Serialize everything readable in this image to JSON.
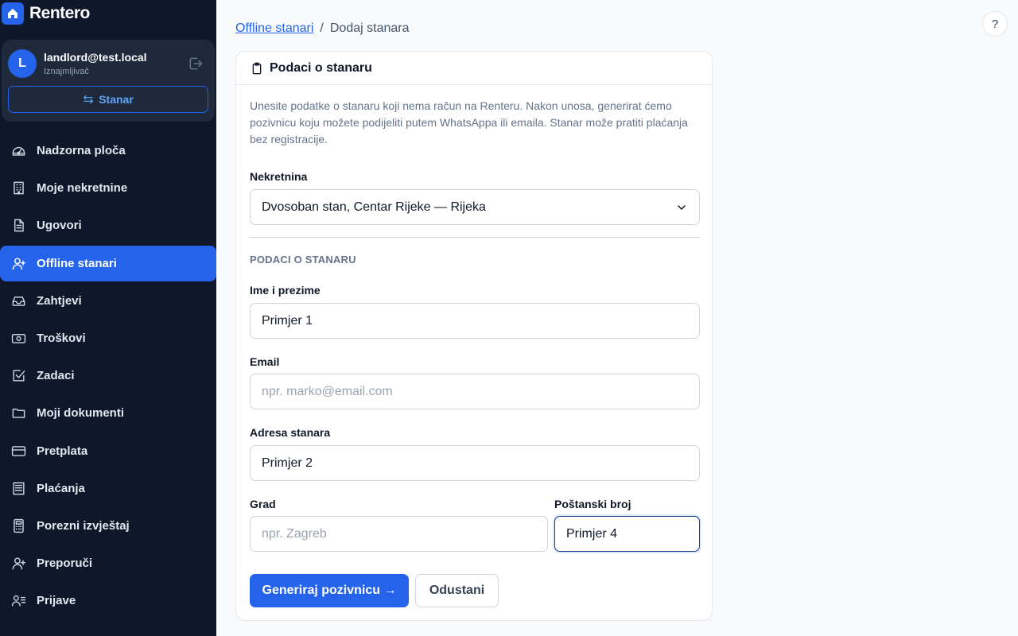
{
  "app": {
    "name": "Rentero"
  },
  "user": {
    "initial": "L",
    "email": "landlord@test.local",
    "role": "Iznajmljivač",
    "switch_label": "Stanar"
  },
  "nav": {
    "items": [
      {
        "label": "Nadzorna ploča",
        "icon": "gauge-icon"
      },
      {
        "label": "Moje nekretnine",
        "icon": "building-icon"
      },
      {
        "label": "Ugovori",
        "icon": "document-icon"
      },
      {
        "label": "Offline stanari",
        "icon": "user-plus-icon",
        "active": true
      },
      {
        "label": "Zahtjevi",
        "icon": "inbox-icon"
      },
      {
        "label": "Troškovi",
        "icon": "money-icon"
      },
      {
        "label": "Zadaci",
        "icon": "checkbox-icon"
      },
      {
        "label": "Moji dokumenti",
        "icon": "folder-icon"
      },
      {
        "label": "Pretplata",
        "icon": "credit-card-icon"
      },
      {
        "label": "Plaćanja",
        "icon": "receipt-icon"
      },
      {
        "label": "Porezni izvještaj",
        "icon": "calculator-icon"
      },
      {
        "label": "Preporuči",
        "icon": "user-plus-icon"
      },
      {
        "label": "Prijave",
        "icon": "user-list-icon"
      }
    ],
    "active_color": "#2563eb"
  },
  "breadcrumb": {
    "parent": "Offline stanari",
    "separator": "/",
    "current": "Dodaj stanara"
  },
  "help": {
    "label": "?"
  },
  "form": {
    "title": "Podaci o stanaru",
    "intro": "Unesite podatke o stanaru koji nema račun na Renteru. Nakon unosa, generirat ćemo pozivnicu koju možete podijeliti putem WhatsAppa ili emaila. Stanar može pratiti plaćanja bez registracije.",
    "property": {
      "label": "Nekretnina",
      "value": "Dvosoban stan, Centar Rijeke — Rijeka"
    },
    "section_title": "PODACI O STANARU",
    "name": {
      "label": "Ime i prezime",
      "value": "Primjer 1"
    },
    "email": {
      "label": "Email",
      "placeholder": "npr. marko@email.com"
    },
    "address": {
      "label": "Adresa stanara",
      "value": "Primjer 2"
    },
    "city": {
      "label": "Grad",
      "placeholder": "npr. Zagreb"
    },
    "postal": {
      "label": "Poštanski broj",
      "value": "Primjer 4"
    },
    "submit_label": "Generiraj pozivnicu →",
    "cancel_label": "Odustani"
  }
}
